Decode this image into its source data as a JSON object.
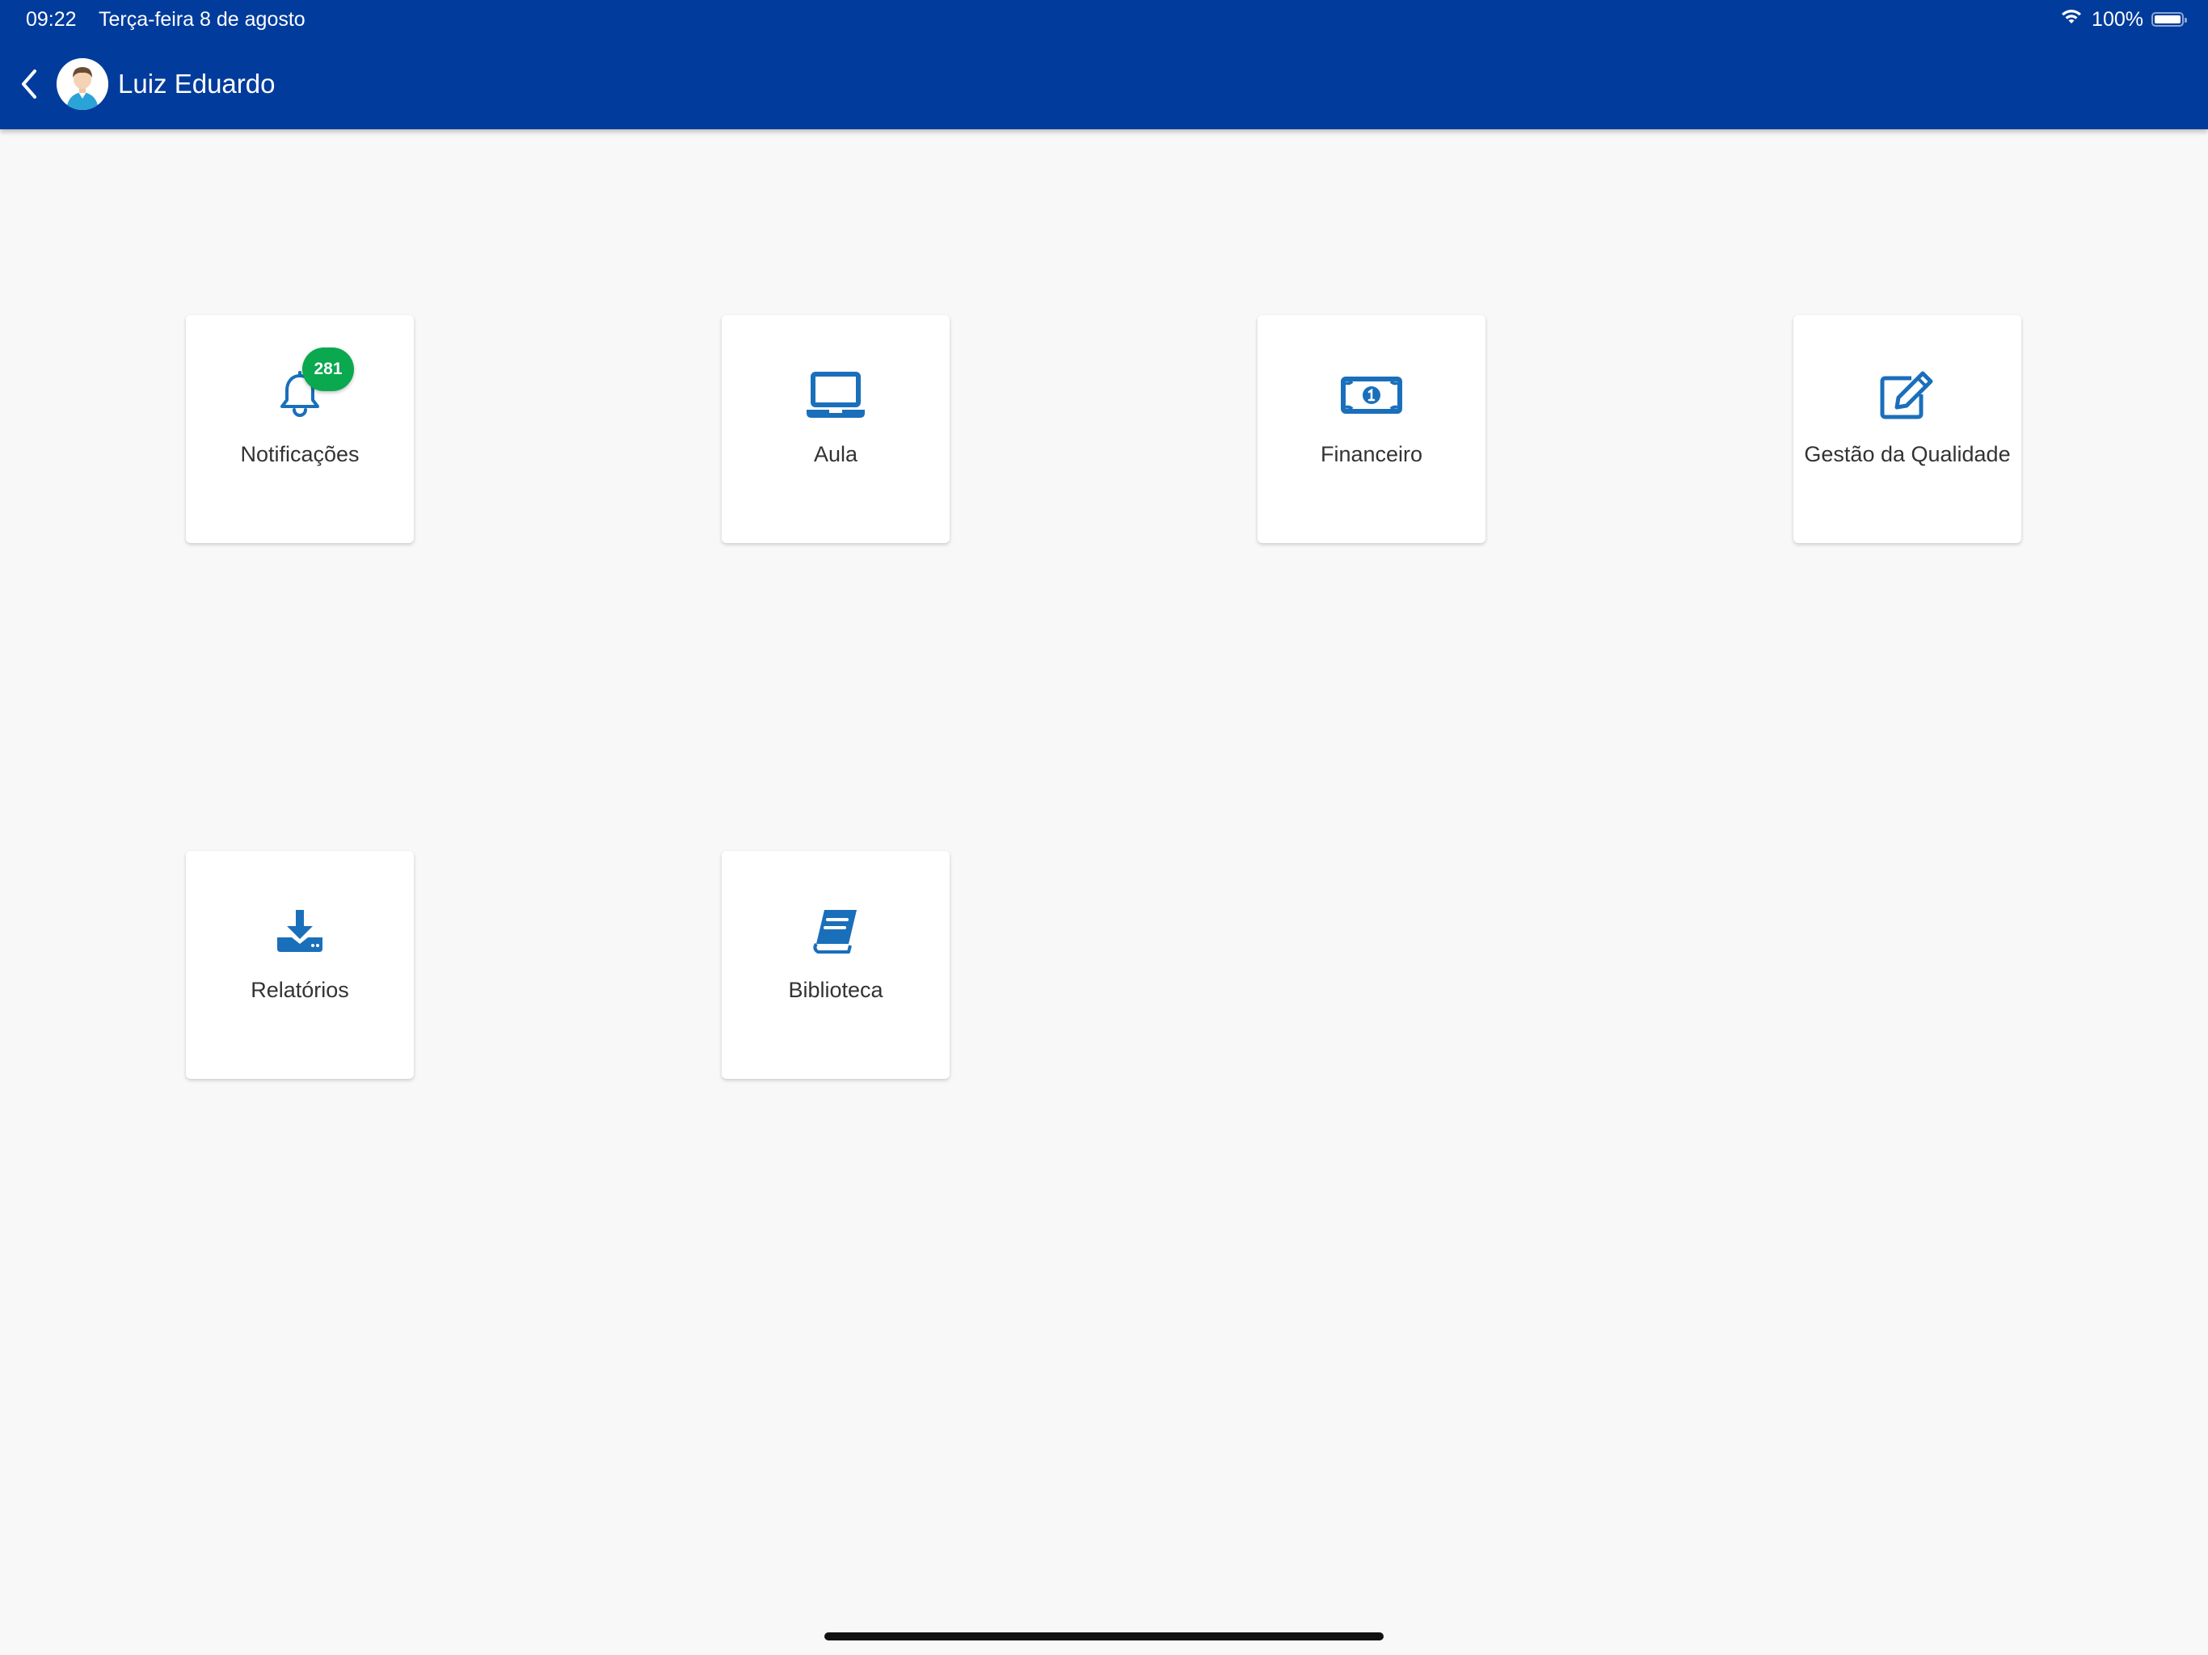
{
  "status_bar": {
    "time": "09:22",
    "date": "Terça-feira 8 de agosto",
    "battery": "100%"
  },
  "header": {
    "user_name": "Luiz Eduardo"
  },
  "colors": {
    "header_bg": "#013c9c",
    "icon": "#1a6fbb",
    "badge": "#0aa84f"
  },
  "menu": [
    {
      "label": "Notificações",
      "icon": "bell-icon",
      "badge": "281"
    },
    {
      "label": "Aula",
      "icon": "laptop-icon"
    },
    {
      "label": "Financeiro",
      "icon": "money-bill-icon"
    },
    {
      "label": "Gestão da Qualidade",
      "icon": "edit-icon"
    },
    {
      "label": "Relatórios",
      "icon": "download-icon"
    },
    {
      "label": "Biblioteca",
      "icon": "book-icon"
    }
  ]
}
